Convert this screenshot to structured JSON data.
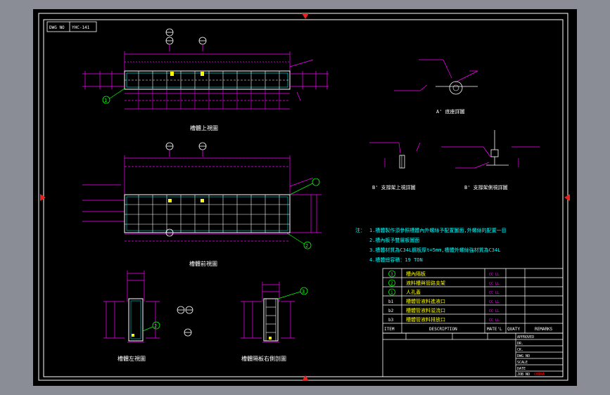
{
  "drawing": {
    "dwg_no_label": "DWG NO",
    "dwg_no_value": "YHC-141",
    "views": {
      "top_view": "槽體上視圖",
      "front_view": "槽體前視圖",
      "left_view": "槽體左視圖",
      "right_section": "槽體隔板右側剖圖",
      "detail_a": "A' 底座詳圖",
      "detail_b_top": "B' 支撐架上視詳圖",
      "detail_b_side": "B' 支撐架側視詳圖"
    },
    "balloons": {
      "one": "1",
      "two": "2",
      "three": "3"
    },
    "notes": {
      "prefix": "注：",
      "n1": "1.槽體製作須參照槽體內外螺絲予配置圖面,外螺絲的配置一目",
      "n2": "2.槽內板予雙層板圖面",
      "n3": "3.槽體材質為C34L鋼板厚t=5mm,槽體外螺絲強材質為C34L",
      "n4": "4.槽體總容積：19 TON"
    },
    "bom": {
      "rows": [
        {
          "item": "3",
          "desc": "槽內隔板",
          "mat": "CC LL"
        },
        {
          "item": "2",
          "desc": "液料槽與管路支架",
          "mat": "CC LL"
        },
        {
          "item": "1",
          "desc": "人孔蓋",
          "mat": "CC LL"
        },
        {
          "item": "b1",
          "desc": "槽體管液料進液口",
          "mat": "CC LL"
        },
        {
          "item": "b2",
          "desc": "槽體管液料溢流口",
          "mat": "CC LL"
        },
        {
          "item": "b3",
          "desc": "槽體管液料排放口",
          "mat": "CC LL"
        }
      ],
      "header": {
        "item": "ITEM",
        "description": "DESCRIPTION",
        "material": "MATE'L",
        "quantity": "QUATY",
        "remarks": "REMARKS"
      }
    },
    "title_block": {
      "approved": "APPROVED",
      "dr": "DR.",
      "ck": "CK.",
      "dwg_no": "DWG NO",
      "scale": "SCALE",
      "date": "DATE",
      "job_no": "JOB NO",
      "china": "CHINA"
    },
    "colors": {
      "background": "#000000",
      "frame": "#ffffff",
      "magenta": "#ff00ff",
      "green": "#00ff00",
      "cyan": "#00ffff",
      "yellow": "#ffff00",
      "red": "#e8231e",
      "screen": "#8a8c96"
    }
  }
}
